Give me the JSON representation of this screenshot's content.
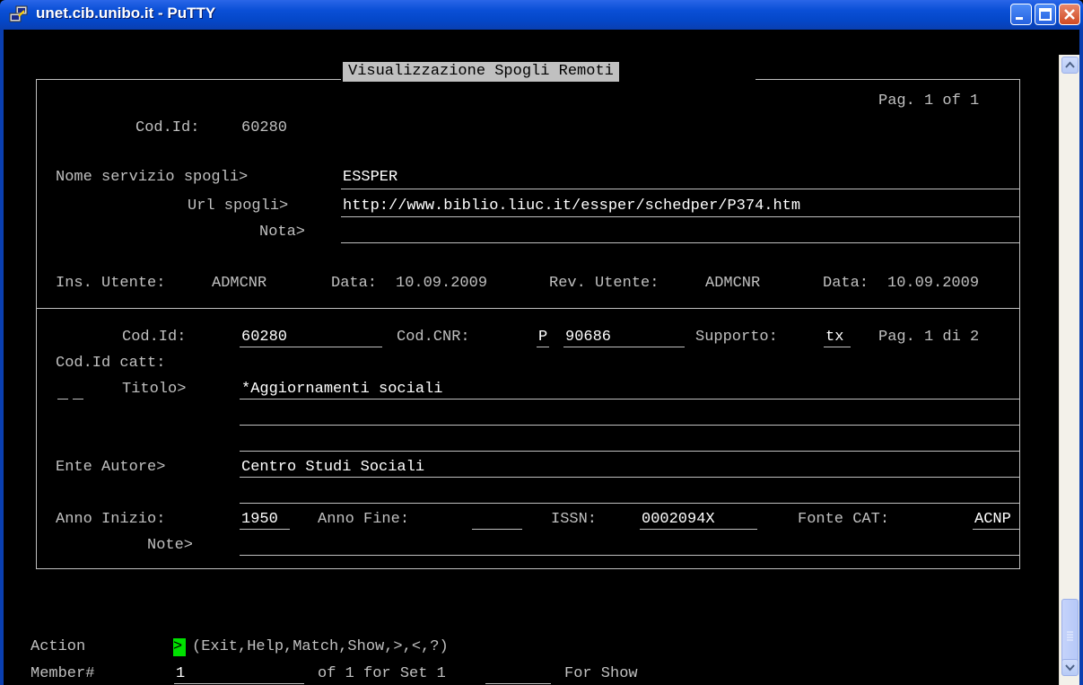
{
  "window": {
    "title": "unet.cib.unibo.it - PuTTY",
    "icon": "putty-icon",
    "controls": {
      "minimize_icon": "minimize-icon",
      "maximize_icon": "maximize-icon",
      "close_icon": "close-icon"
    }
  },
  "screen": {
    "header": "Visualizzazione Spogli Remoti",
    "page_top": "Pag. 1 of 1",
    "top": {
      "codid_label": "Cod.Id:",
      "codid_value": "60280",
      "nome_label": "Nome servizio spogli>",
      "nome_value": "ESSPER",
      "url_label": "Url spogli>",
      "url_value": "http://www.biblio.liuc.it/essper/schedper/P374.htm",
      "nota_label": "Nota>",
      "nota_value": "",
      "ins_label": "Ins. Utente:",
      "ins_value": "ADMCNR",
      "data1_label": "Data:",
      "data1_value": "10.09.2009",
      "rev_label": "Rev. Utente:",
      "rev_value": "ADMCNR",
      "data2_label": "Data:",
      "data2_value": "10.09.2009"
    },
    "bottom": {
      "codid_label": "Cod.Id:",
      "codid_value": "60280",
      "codcnr_label": "Cod.CNR:",
      "codcnr_prefix": "P",
      "codcnr_value": "90686",
      "supporto_label": "Supporto:",
      "supporto_value": "tx",
      "pag": "Pag. 1 di 2",
      "codidcatt_label": "Cod.Id catt:",
      "titolo_label": "Titolo>",
      "titolo_value": "*Aggiornamenti sociali",
      "ente_label": "Ente Autore>",
      "ente_value": "Centro Studi Sociali",
      "anno_inizio_label": "Anno Inizio:",
      "anno_inizio_value": "1950",
      "anno_fine_label": "Anno Fine:",
      "anno_fine_value": "",
      "issn_label": "ISSN:",
      "issn_value": "0002094X",
      "fonte_label": "Fonte CAT:",
      "fonte_value": "ACNP",
      "note_label": "Note>"
    },
    "action": {
      "label": "Action",
      "cursor": ">",
      "options": "(Exit,Help,Match,Show,>,<,?)"
    },
    "member": {
      "label": "Member#",
      "value": "1",
      "text": "of 1 for Set 1",
      "for_show": "For Show"
    }
  }
}
